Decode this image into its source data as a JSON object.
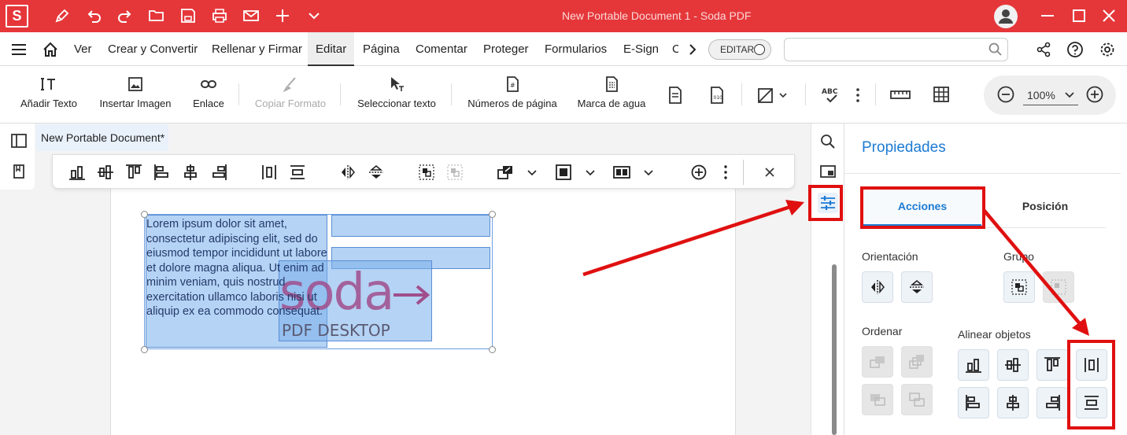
{
  "titlebar": {
    "logo": "S",
    "title": "New Portable Document 1   -   Soda PDF",
    "icons": [
      "pen-icon",
      "undo-icon",
      "redo-icon",
      "folder-open-icon",
      "save-icon",
      "print-icon",
      "mail-icon",
      "plus-icon",
      "chevron-down-icon",
      "user-icon",
      "minimize-icon",
      "maximize-icon",
      "close-icon"
    ]
  },
  "menubar": {
    "items": [
      "Ver",
      "Crear y Convertir",
      "Rellenar y Firmar",
      "Editar",
      "Página",
      "Comentar",
      "Proteger",
      "Formularios",
      "E-Sign",
      "C"
    ],
    "active": "Editar",
    "toggle_label": "EDITAR",
    "search_placeholder": ""
  },
  "ribbon": {
    "add_text": "Añadir Texto",
    "insert_image": "Insertar Imagen",
    "link": "Enlace",
    "copy_format": "Copiar Formato",
    "select_text": "Seleccionar texto",
    "page_numbers": "Números de página",
    "watermark": "Marca de agua",
    "zoom": "100%"
  },
  "document": {
    "tab_title": "New Portable Document*",
    "lorem": "Lorem ipsum dolor sit amet, consectetur adipiscing elit, sed do eiusmod tempor incididunt ut labore et dolore magna aliqua. Ut enim ad minim veniam, quis nostrud exercitation ullamco laboris nisi ut aliquip ex ea commodo consequat.",
    "logo_word": "soda",
    "logo_sub": "PDF DESKTOP"
  },
  "panel": {
    "title": "Propiedades",
    "tab_actions": "Acciones",
    "tab_position": "Posición",
    "orientation": "Orientación",
    "group": "Grupo",
    "order": "Ordenar",
    "align": "Alinear objetos"
  },
  "colors": {
    "titlebar": "#e5373a",
    "accent": "#1c7bd3",
    "highlight": "#e01010"
  }
}
